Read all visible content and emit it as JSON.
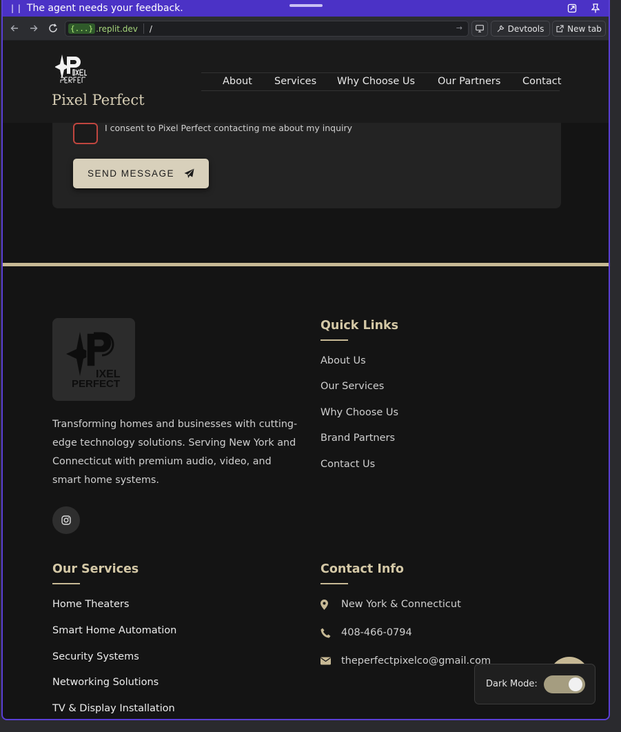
{
  "agent_bar": {
    "message": "The agent needs your feedback.",
    "pause_icon": "pause-icon",
    "expand_icon": "popout-icon",
    "pin_icon": "pin-icon"
  },
  "browser": {
    "url_tag": "{...}",
    "url_domain": ".replit.dev",
    "url_path": "/",
    "devtools_label": "Devtools",
    "newtab_label": "New tab"
  },
  "header": {
    "logo_alt": "Pixel Perfect logo",
    "brand": "Pixel Perfect",
    "nav": [
      "About",
      "Services",
      "Why Choose Us",
      "Our Partners",
      "Contact"
    ]
  },
  "form": {
    "consent_text": "I consent to Pixel Perfect contacting me about my inquiry",
    "send_label": "SEND MESSAGE"
  },
  "footer": {
    "description": "Transforming homes and businesses with cutting-edge technology solutions. Serving New York and Connecticut with premium audio, video, and smart home systems.",
    "quick_links_title": "Quick Links",
    "quick_links": [
      "About Us",
      "Our Services",
      "Why Choose Us",
      "Brand Partners",
      "Contact Us"
    ],
    "services_title": "Our Services",
    "services": [
      "Home Theaters",
      "Smart Home Automation",
      "Security Systems",
      "Networking Solutions",
      "TV & Display Installation"
    ],
    "contact_title": "Contact Info",
    "contact": {
      "location": "New York & Connecticut",
      "phone": "408-466-0794",
      "email": "theperfectpixelco@gmail.com"
    }
  },
  "dark_mode": {
    "label": "Dark Mode:",
    "enabled": true
  },
  "colors": {
    "accent": "#c7b995",
    "agent_bar": "#4b32c6",
    "background": "#141414"
  }
}
